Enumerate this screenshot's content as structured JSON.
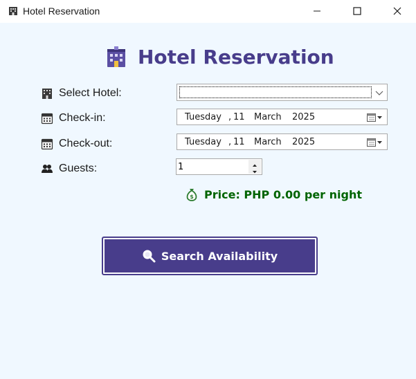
{
  "window": {
    "title": "Hotel Reservation",
    "icon": "hotel-icon"
  },
  "form": {
    "heading": "Hotel Reservation",
    "select_hotel": {
      "label": "Select Hotel:",
      "value": "",
      "icon": "hotel-icon"
    },
    "check_in": {
      "label": "Check-in:",
      "weekday": "Tuesday",
      "day": "11",
      "month": "March",
      "year": "2025",
      "icon": "calendar-icon"
    },
    "check_out": {
      "label": "Check-out:",
      "weekday": "Tuesday",
      "day": "11",
      "month": "March",
      "year": "2025",
      "icon": "calendar-icon"
    },
    "guests": {
      "label": "Guests:",
      "value": "1",
      "icon": "people-icon"
    },
    "price": {
      "text": "Price: PHP 0.00 per night",
      "icon": "money-bag-icon"
    },
    "search_button": {
      "label": "Search Availability",
      "icon": "magnifier-icon"
    }
  },
  "colors": {
    "background": "#f0f8ff",
    "accent": "#483d8b",
    "price": "#006400"
  }
}
